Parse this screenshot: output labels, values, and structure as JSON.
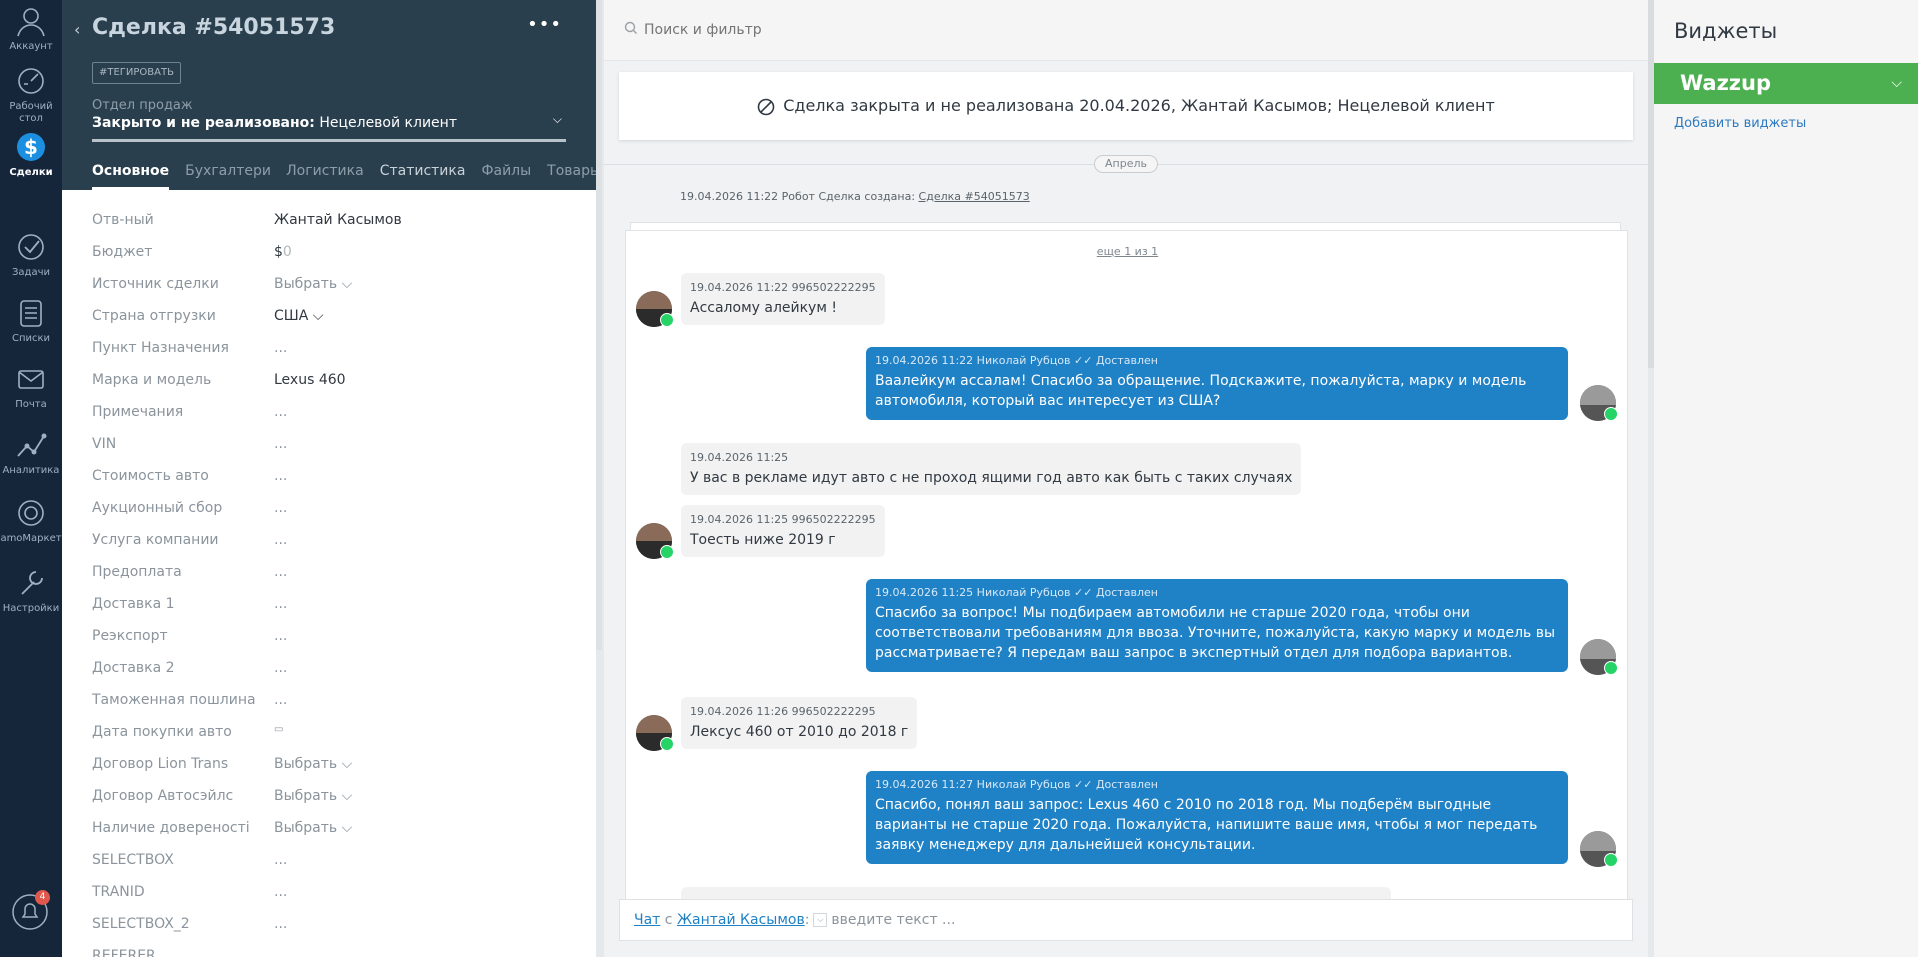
{
  "nav": {
    "items": [
      {
        "label": "Аккаунт",
        "icon": "account-icon"
      },
      {
        "label": "Рабочий стол",
        "icon": "dashboard-icon"
      },
      {
        "label": "Сделки",
        "icon": "deals-icon"
      },
      {
        "label": "Задачи",
        "icon": "tasks-icon"
      },
      {
        "label": "Списки",
        "icon": "lists-icon"
      },
      {
        "label": "Почта",
        "icon": "mail-icon"
      },
      {
        "label": "Аналитика",
        "icon": "analytics-icon"
      },
      {
        "label": "amoМаркет",
        "icon": "market-icon"
      },
      {
        "label": "Настройки",
        "icon": "settings-icon"
      }
    ],
    "notifications_count": "4"
  },
  "card": {
    "title": "Сделка #54051573",
    "tag_button": "#ТЕГИРОВАТЬ",
    "pipeline_label": "Отдел продаж",
    "status_main": "Закрыто и не реализовано:",
    "status_reason": " Нецелевой клиент",
    "tabs": [
      "Основное",
      "Бухгалтерия",
      "Логистика",
      "Статистика",
      "Файлы",
      "Товары",
      "…"
    ],
    "fields": [
      {
        "label": "Отв-ный",
        "value": "Жантай Касымов"
      },
      {
        "label": "Бюджет",
        "value": ""
      },
      {
        "label": "Источник сделки",
        "value": "Выбрать ⌵"
      },
      {
        "label": "Страна отгрузки",
        "value": "США ⌵"
      },
      {
        "label": "Пункт Назначения",
        "value": "..."
      },
      {
        "label": "Марка и модель",
        "value": "Lexus 460"
      },
      {
        "label": "Примечания",
        "value": "..."
      },
      {
        "label": "VIN",
        "value": "..."
      },
      {
        "label": "Стоимость авто",
        "value": "..."
      },
      {
        "label": "Аукционный сбор",
        "value": "..."
      },
      {
        "label": "Услуга компании",
        "value": "..."
      },
      {
        "label": "Предоплата",
        "value": "..."
      },
      {
        "label": "Доставка 1",
        "value": "..."
      },
      {
        "label": "Реэкспорт",
        "value": "..."
      },
      {
        "label": "Доставка 2",
        "value": "..."
      },
      {
        "label": "Таможенная пошлина",
        "value": "..."
      },
      {
        "label": "Дата покупки авто",
        "value": "▭"
      },
      {
        "label": "Договор Lion Trans",
        "value": "Выбрать ⌵"
      },
      {
        "label": "Договор Автосэйлс",
        "value": "Выбрать ⌵"
      },
      {
        "label": "Наличие довереностi",
        "value": "Выбрать ⌵"
      },
      {
        "label": "SELECTBOX",
        "value": "..."
      },
      {
        "label": "TRANID",
        "value": "..."
      },
      {
        "label": "SELECTBOX_2",
        "value": "..."
      },
      {
        "label": "REFERER",
        "value": ""
      }
    ],
    "budget_currency": "$",
    "budget_value": "0"
  },
  "feed": {
    "search_placeholder": "Поиск и фильтр",
    "closed_banner": "Сделка закрыта и не реализована 20.04.2026, Жантай Касымов; Нецелевой клиент",
    "month": "Апрель",
    "robot_note": "19.04.2026 11:22 Робот Сделка создана:",
    "robot_link": "Сделка #54051573",
    "more_link": "еще 1 из 1",
    "messages": [
      {
        "dir": "in",
        "meta": "19.04.2026 11:22 996502222295",
        "text": "Ассалому алейкум !"
      },
      {
        "dir": "out",
        "meta": "19.04.2026 11:22 Николай Рубцов ✓✓ Доставлен",
        "text": "Ваалейкум ассалам! Спасибо за обращение. Подскажите, пожалуйста, марку и модель автомобиля, который вас интересует из США?"
      },
      {
        "dir": "in",
        "meta": "19.04.2026 11:25",
        "text": "У вас в рекламе идут авто с не проход ящими год авто как быть с таких случаях"
      },
      {
        "dir": "in",
        "meta": "19.04.2026 11:25 996502222295",
        "text": "Тоесть ниже 2019 г"
      },
      {
        "dir": "out",
        "meta": "19.04.2026 11:25 Николай Рубцов ✓✓ Доставлен",
        "text": "Спасибо за вопрос! Мы подбираем автомобили не старше 2020 года, чтобы они соответствовали требованиям для ввоза. Уточните, пожалуйста, какую марку и модель вы рассматриваете? Я передам ваш запрос в экспертный отдел для подбора вариантов."
      },
      {
        "dir": "in",
        "meta": "19.04.2026 11:26 996502222295",
        "text": "Лексус 460 от 2010 до 2018 г"
      },
      {
        "dir": "out",
        "meta": "19.04.2026 11:27 Николай Рубцов ✓✓ Доставлен",
        "text": "Спасибо, понял ваш запрос: Lexus 460 с 2010 по 2018 год. Мы подберём выгодные варианты не старше 2020 года. Пожалуйста, напишите ваше имя, чтобы я мог передать заявку менеджеру для дальнейшей консультации."
      }
    ],
    "composer": {
      "chat_link": "Чат",
      "with": " с ",
      "contact_link": "Жантай Касымов",
      "colon": ":",
      "placeholder": "введите текст ..."
    }
  },
  "widgets": {
    "title": "Виджеты",
    "wazzup": "Wazzup",
    "add_link": "Добавить виджеты"
  },
  "colors": {
    "nav_bg": "#15263a",
    "card_head_bg": "#2a3f4e",
    "outgoing_bubble": "#1f81c6",
    "wazzup_green": "#4cb050",
    "whatsapp_green": "#25d366"
  }
}
